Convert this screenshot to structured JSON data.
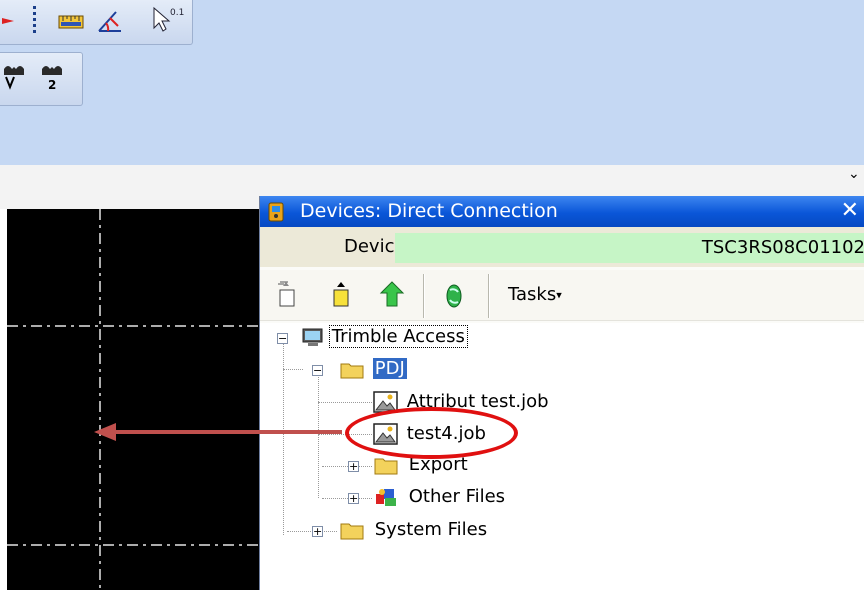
{
  "window": {
    "title": "Devices: Direct Connection",
    "close_glyph": "✕"
  },
  "device": {
    "label": "Device:",
    "value": "TSC3RS08C01102"
  },
  "toolbar": {
    "tasks_label": "Tasks",
    "tasks_arrow": "▾",
    "buttons": [
      "copy-from-icon",
      "copy-to-icon",
      "up-folder-icon",
      "sync-icon"
    ]
  },
  "tree": {
    "root": "Trimble Access",
    "pdj": "PDJ",
    "file1": "Attribut test.job",
    "file2": "test4.job",
    "export": "Export",
    "other": "Other Files",
    "system": "System Files",
    "expand_glyph": "+",
    "collapse_glyph": "−"
  },
  "colors": {
    "title_bar": "#0a56d8",
    "device_bg": "#c6f5c6",
    "selection": "#316ac5",
    "annotation": "#e01010",
    "arrow": "#c0504d"
  },
  "top_toolbar_icons": [
    "ruler-icon",
    "angle-measure-icon",
    "cursor-tolerance-icon",
    "view-1-icon",
    "view-2-icon"
  ],
  "chevron": "⌄"
}
